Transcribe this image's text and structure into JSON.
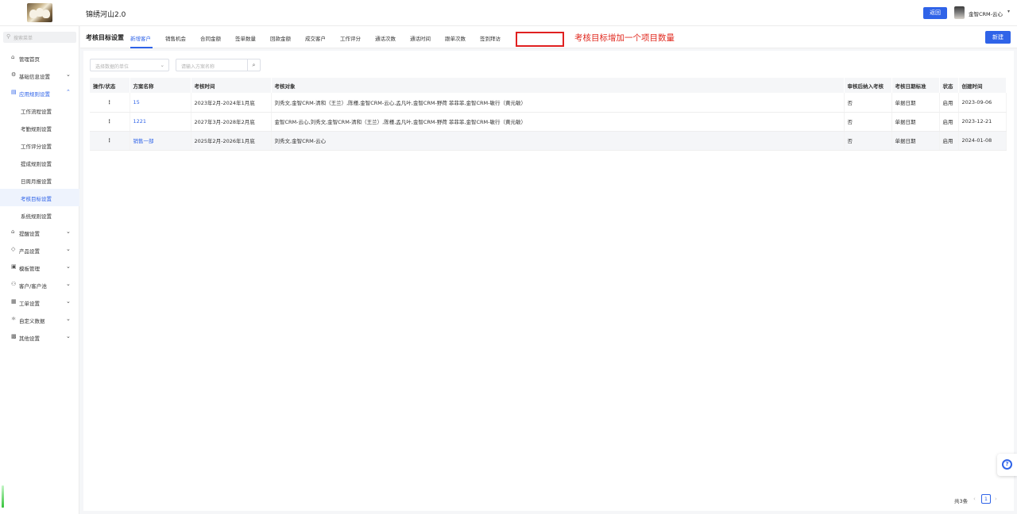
{
  "header": {
    "app_title": "锦绣河山2.0",
    "back_label": "返回",
    "user_name": "金智CRM-云心",
    "user_caret": "▾"
  },
  "sidebar": {
    "search_placeholder": "搜索菜单",
    "items": [
      {
        "icon": "⌂",
        "label": "管理首页"
      },
      {
        "icon": "⚙",
        "label": "基础信息设置",
        "caret": "⌄"
      },
      {
        "icon": "▤",
        "label": "应用规则设置",
        "caret": "⌃"
      },
      {
        "icon": "⌂",
        "label": "提醒设置",
        "caret": "⌄"
      },
      {
        "icon": "◇",
        "label": "产品设置",
        "caret": "⌄"
      },
      {
        "icon": "▣",
        "label": "模板管理",
        "caret": "⌄"
      },
      {
        "icon": "⚇",
        "label": "客户/客户池",
        "caret": "⌄"
      },
      {
        "icon": "▦",
        "label": "工单设置",
        "caret": "⌄"
      },
      {
        "icon": "⚛",
        "label": "自定义数据",
        "caret": "⌄"
      },
      {
        "icon": "▩",
        "label": "其他设置",
        "caret": "⌄"
      }
    ],
    "sub_items": [
      "工作流程设置",
      "考勤规则设置",
      "工作评分设置",
      "提成规则设置",
      "日周月报设置",
      "考核目标设置",
      "系统规则设置"
    ]
  },
  "content": {
    "page_title": "考核目标设置",
    "tabs": [
      "新增客户",
      "销售机会",
      "合同金额",
      "签单数量",
      "回款金额",
      "成交客户",
      "工作评分",
      "通话次数",
      "通话时间",
      "跟单次数",
      "签到拜访"
    ],
    "annotation": "考核目标增加一个项目数量",
    "new_label": "新建"
  },
  "filters": {
    "select_placeholder": "选择数据的单位",
    "select_caret": "⌄",
    "keyword_placeholder": "请输入方案名称",
    "search_icon": "⌕"
  },
  "table": {
    "headers": [
      "操作/状态",
      "方案名称",
      "考核时间",
      "考核对象",
      "审核后纳入考核",
      "考核日期标准",
      "状态",
      "创建时间"
    ],
    "rows": [
      {
        "ops": "⋮",
        "name": "15",
        "period": "2023年2月-2024年1月底",
        "targets": "刘秀文,金智CRM-清和（王兰）,陈槿,金智CRM-云心,孟凡叶,金智CRM-野荷 菲菲菲,金智CRM-敏行（黄元敏）",
        "audit": "否",
        "date_std": "单据日期",
        "status": "启用",
        "created": "2023-09-06"
      },
      {
        "ops": "⋮",
        "name": "1221",
        "period": "2027年3月-2028年2月底",
        "targets": "金智CRM-云心,刘秀文,金智CRM-清和（王兰）,陈槿,孟凡叶,金智CRM-野荷 菲菲菲,金智CRM-敏行（黄元敏）",
        "audit": "否",
        "date_std": "单据日期",
        "status": "启用",
        "created": "2023-12-21"
      },
      {
        "ops": "⋮",
        "name": "销售一部",
        "period": "2025年2月-2026年1月底",
        "targets": "刘秀文,金智CRM-云心",
        "audit": "否",
        "date_std": "单据日期",
        "status": "启用",
        "created": "2024-01-08"
      }
    ]
  },
  "pager": {
    "total": "共3条",
    "prev": "‹",
    "current": "1",
    "next": "›"
  },
  "float_help": {
    "icon": "?"
  },
  "colors": {
    "accent": "#2f63e8",
    "annotation": "#e0281e"
  }
}
